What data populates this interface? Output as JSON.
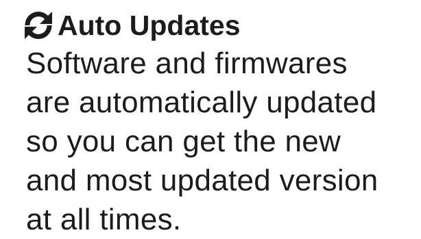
{
  "feature": {
    "icon": "sync-icon",
    "title": "Auto Updates",
    "description_lines": [
      "Software and firmwares",
      "are automatically updated",
      "so you can get the new",
      "and most updated version",
      "at all times."
    ]
  }
}
